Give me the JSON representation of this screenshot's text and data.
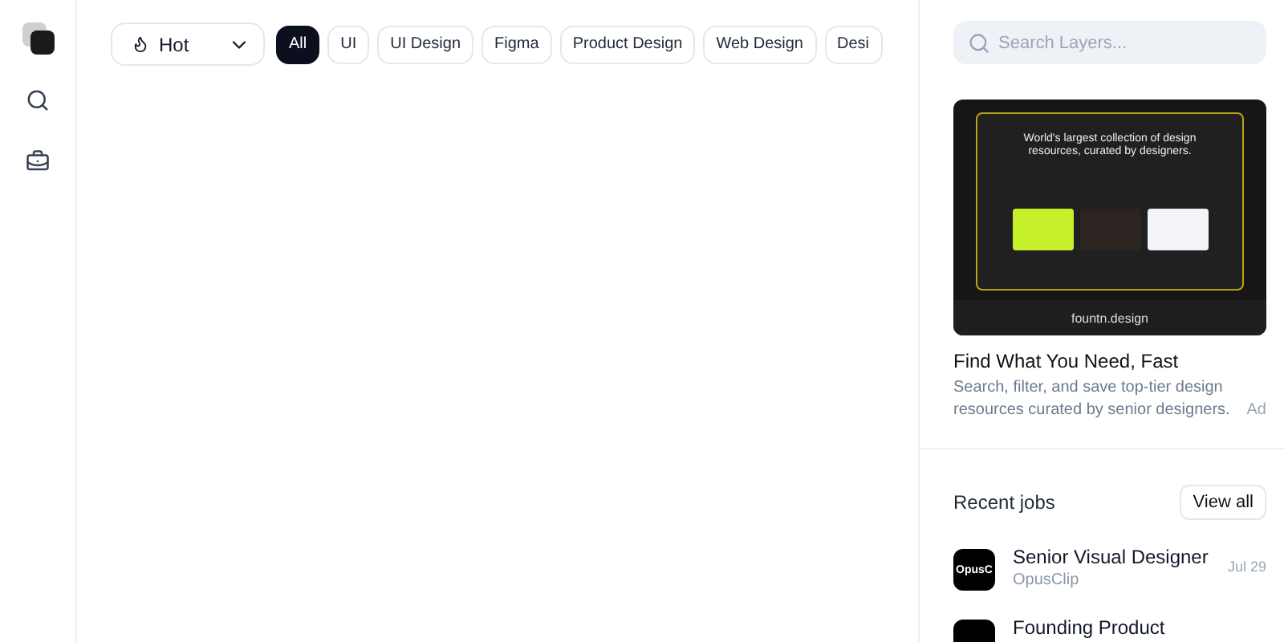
{
  "sidebar": {
    "items": [
      {
        "kind": "logo",
        "selected": false
      },
      {
        "kind": "search",
        "selected": false
      },
      {
        "kind": "jobs",
        "selected": false
      }
    ]
  },
  "filter": {
    "sort": "Hot"
  },
  "tags": [
    {
      "label": "All",
      "selected": true
    },
    {
      "label": "UI",
      "selected": false
    },
    {
      "label": "UI Design",
      "selected": false
    },
    {
      "label": "Figma",
      "selected": false
    },
    {
      "label": "Product Design",
      "selected": false
    },
    {
      "label": "Web Design",
      "selected": false
    },
    {
      "label": "Desi",
      "selected": false
    }
  ],
  "search": {
    "placeholder": "Search Layers..."
  },
  "ad": {
    "headline": "World's largest collection of design resources, curated by designers.",
    "brand": "fountn.design",
    "title": "Find What You Need, Fast",
    "description": "Search, filter, and save top-tier design resources curated by senior designers.",
    "badge": "Ad"
  },
  "jobs": {
    "title": "Recent jobs",
    "view_all": "View all",
    "items": [
      {
        "logo": "OpusC",
        "title": "Senior Visual Designer",
        "company": "OpusClip",
        "date": "Jul 29"
      },
      {
        "title": "Founding Product"
      }
    ]
  }
}
